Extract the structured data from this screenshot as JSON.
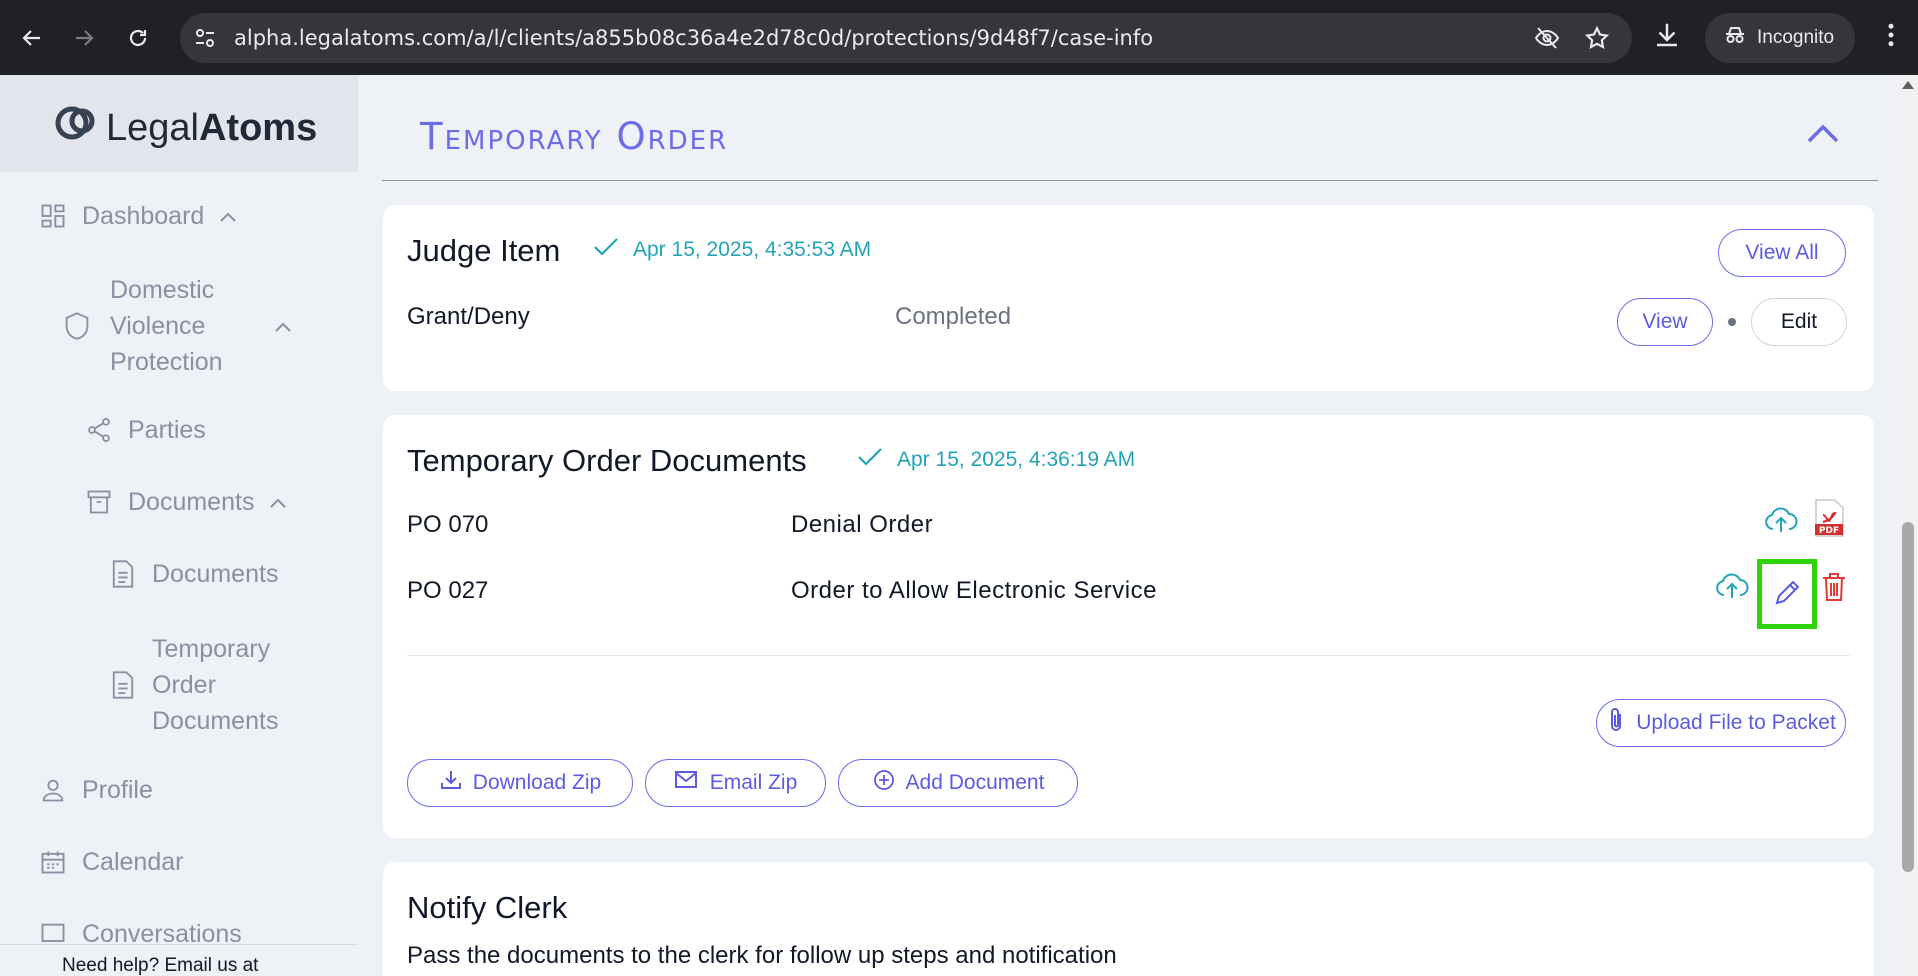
{
  "browser": {
    "url": "alpha.legalatoms.com/a/l/clients/a855b08c36a4e2d78c0d/protections/9d48f7/case-info",
    "incognito_label": "Incognito"
  },
  "sidebar": {
    "logo_light": "Legal",
    "logo_bold": "Atoms",
    "items": [
      {
        "label": "Dashboard"
      },
      {
        "label_lines": [
          "Domestic",
          "Violence",
          "Protection"
        ]
      },
      {
        "label": "Parties"
      },
      {
        "label": "Documents"
      },
      {
        "label": "Documents"
      },
      {
        "label_lines": [
          "Temporary",
          "Order",
          "Documents"
        ]
      },
      {
        "label": "Profile"
      },
      {
        "label": "Calendar"
      },
      {
        "label": "Conversations"
      }
    ],
    "help_text": "Need help? Email us at"
  },
  "main": {
    "section_title": "Temporary Order",
    "judge_card": {
      "title": "Judge Item",
      "timestamp": "Apr 15, 2025, 4:35:53 AM",
      "view_all_label": "View All",
      "row": {
        "name": "Grant/Deny",
        "status": "Completed"
      },
      "view_label": "View",
      "edit_label": "Edit"
    },
    "documents_card": {
      "title": "Temporary Order Documents",
      "timestamp": "Apr 15, 2025, 4:36:19 AM",
      "rows": [
        {
          "code": "PO 070",
          "name": "Denial Order"
        },
        {
          "code": "PO 027",
          "name": "Order to Allow Electronic Service"
        }
      ],
      "upload_label": "Upload File to Packet",
      "download_zip_label": "Download Zip",
      "email_zip_label": "Email Zip",
      "add_document_label": "Add Document"
    },
    "notify_card": {
      "title": "Notify Clerk",
      "description": "Pass the documents to the clerk for follow up steps and notification"
    }
  },
  "colors": {
    "accent": "#6c6ce8",
    "teal": "#23a3b6",
    "danger": "#e53935",
    "highlight": "#2fd40a"
  }
}
